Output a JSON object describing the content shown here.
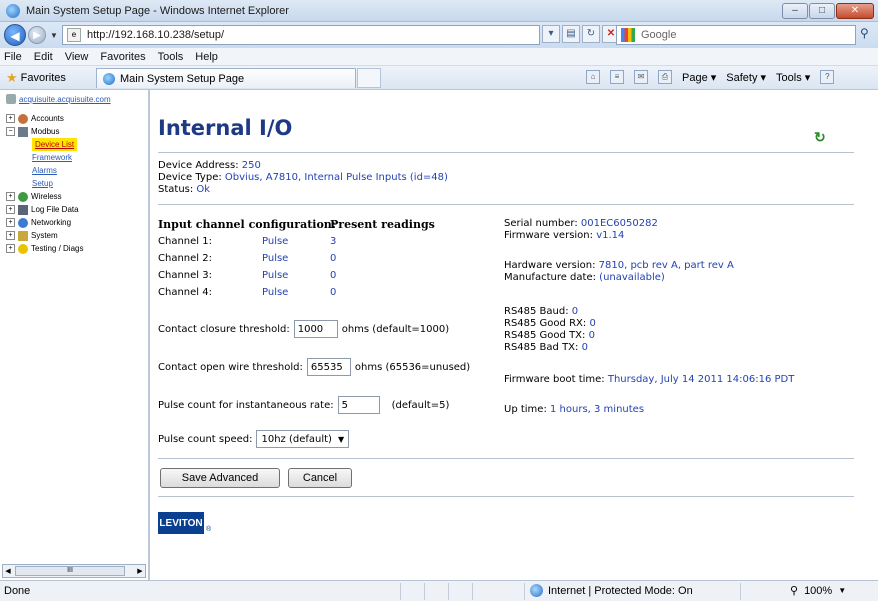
{
  "window": {
    "title": "Main System Setup Page - Windows Internet Explorer",
    "buttons": [
      "–",
      "□",
      "✕"
    ]
  },
  "address": {
    "url": "http://192.168.10.238/setup/",
    "search_placeholder": "Google"
  },
  "menu": [
    "File",
    "Edit",
    "View",
    "Favorites",
    "Tools",
    "Help"
  ],
  "favorites": {
    "label": "Favorites",
    "tab_label": "Main System Setup Page",
    "commands": [
      "Page ▾",
      "Safety ▾",
      "Tools ▾"
    ]
  },
  "tree": {
    "root": "acquisuite.acquisuite.com",
    "items": [
      {
        "label": "Accounts",
        "toggle": "+"
      },
      {
        "label": "Modbus",
        "toggle": "−"
      },
      {
        "label": "Wireless",
        "toggle": "+"
      },
      {
        "label": "Log File Data",
        "toggle": "+"
      },
      {
        "label": "Networking",
        "toggle": "+"
      },
      {
        "label": "System",
        "toggle": "+"
      },
      {
        "label": "Testing / Diags",
        "toggle": "+"
      }
    ],
    "modbus_children": [
      "Device List",
      "Framework",
      "Alarms",
      "Setup"
    ],
    "scroll_label": "III"
  },
  "main": {
    "title": "Internal I/O",
    "device_address_label": "Device Address:",
    "device_address": "250",
    "device_type_label": "Device Type:",
    "device_type": "Obvius, A7810, Internal Pulse Inputs (id=48)",
    "status_label": "Status:",
    "status": "Ok",
    "cfg_header": "Input channel configuration:",
    "readings_header": "Present readings",
    "channels": [
      {
        "name": "Channel 1:",
        "type": "Pulse",
        "reading": "3"
      },
      {
        "name": "Channel 2:",
        "type": "Pulse",
        "reading": "0"
      },
      {
        "name": "Channel 3:",
        "type": "Pulse",
        "reading": "0"
      },
      {
        "name": "Channel 4:",
        "type": "Pulse",
        "reading": "0"
      }
    ],
    "serial_label": "Serial number:",
    "serial": "001EC6050282",
    "firmware_label": "Firmware version:",
    "firmware": "v1.14",
    "hardware_label": "Hardware version:",
    "hardware": "7810, pcb rev A, part rev A",
    "manufacture_label": "Manufacture date:",
    "manufacture": "(unavailable)",
    "rs485_baud_label": "RS485 Baud:",
    "rs485_baud": "0",
    "rs485_good_rx_label": "RS485 Good RX:",
    "rs485_good_rx": "0",
    "rs485_good_tx_label": "RS485 Good TX:",
    "rs485_good_tx": "0",
    "rs485_bad_tx_label": "RS485 Bad TX:",
    "rs485_bad_tx": "0",
    "boot_label": "Firmware boot time:",
    "boot": "Thursday, July 14 2011 14:06:16 PDT",
    "uptime_label": "Up time:",
    "uptime": "1 hours, 3 minutes",
    "closure_label": "Contact closure threshold:",
    "closure_value": "1000",
    "closure_suffix": "ohms (default=1000)",
    "openwire_label": "Contact open wire threshold:",
    "openwire_value": "65535",
    "openwire_suffix": "ohms (65536=unused)",
    "pulsecount_label": "Pulse count for instantaneous rate:",
    "pulsecount_value": "5",
    "pulsecount_suffix": "(default=5)",
    "speed_label": "Pulse count speed:",
    "speed_value": "10hz (default)",
    "save_button": "Save Advanced",
    "cancel_button": "Cancel",
    "logo_text": "LEVITON",
    "logo_reg": "®"
  },
  "status": {
    "left": "Done",
    "zone": "Internet | Protected Mode: On",
    "zoom": "100%"
  },
  "colors": {
    "title": "#1f3a85",
    "value_blue": "#2342b3",
    "selected_bg": "#ffe600",
    "logo_bg": "#0b3f8f"
  }
}
